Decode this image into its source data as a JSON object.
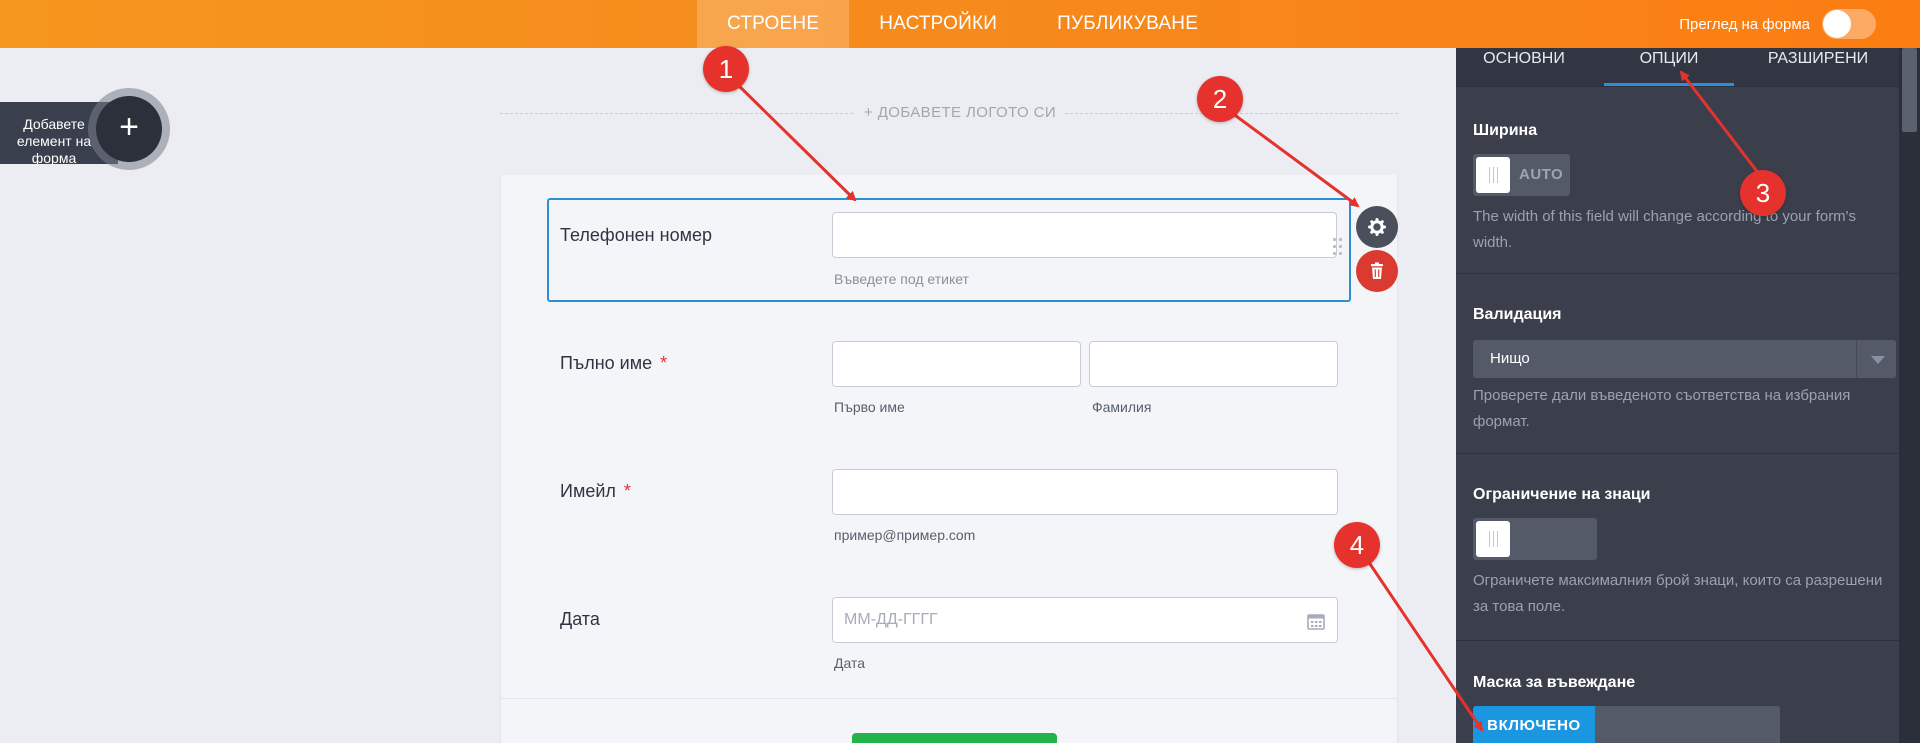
{
  "topbar": {
    "tabs": [
      "СТРОЕНЕ",
      "НАСТРОЙКИ",
      "ПУБЛИКУВАНЕ"
    ],
    "preview_label": "Преглед на форма",
    "preview_on": false
  },
  "add_element": {
    "label": "Добавете елемент на форма",
    "button_symbol": "+"
  },
  "logo": {
    "text": "+ ДОБАВЕТЕ ЛОГОТО СИ"
  },
  "form": {
    "phone": {
      "label": "Телефонен номер",
      "value": "",
      "sublabel": "Въведете под етикет"
    },
    "fullname": {
      "label": "Пълно име",
      "required": "*",
      "first_sublabel": "Първо име",
      "last_sublabel": "Фамилия"
    },
    "email": {
      "label": "Имейл",
      "required": "*",
      "sublabel": "пример@пример.com"
    },
    "date": {
      "label": "Дата",
      "placeholder": "ММ-ДД-ГГГГ",
      "sublabel": "Дата"
    }
  },
  "panel": {
    "tabs": [
      "ОСНОВНИ",
      "ОПЦИИ",
      "РАЗШИРЕНИ"
    ],
    "active_tab": "ОПЦИИ",
    "width": {
      "title": "Ширина",
      "toggle_text": "AUTO",
      "desc": "The width of this field will change according to your form's width."
    },
    "validation": {
      "title": "Валидация",
      "selected": "Нищо",
      "desc": "Проверете дали въведеното съответства на избрания формат."
    },
    "char_limit": {
      "title": "Ограничение на знаци",
      "desc": "Ограничете максималния брой знаци, които са разрешени за това поле."
    },
    "input_mask": {
      "title": "Маска за въвеждане",
      "toggle_text": "ВКЛЮЧЕНО"
    }
  },
  "annotations": [
    "1",
    "2",
    "3",
    "4"
  ],
  "colors": {
    "accent_orange": "#f68a1c",
    "annotation_red": "#e5322d",
    "selected_blue": "#2d8fd2",
    "panel_bg": "#3b3f4c"
  }
}
